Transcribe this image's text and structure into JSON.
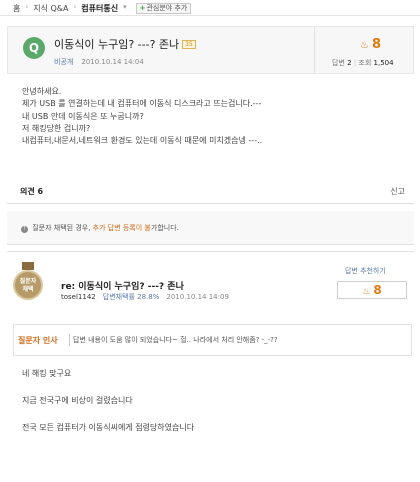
{
  "breadcrumb": {
    "items": [
      "홈",
      "지식 Q&A",
      "컴퓨터통신"
    ],
    "add_fav_label": "관심분야 추가"
  },
  "question": {
    "badge": "Q",
    "title": "이동식이 누구임? ---? 존나",
    "level_badge": "35",
    "author": "비공개",
    "date": "2010.10.14 14:04",
    "score": "8",
    "answers_label": "답변",
    "answers": "2",
    "views_label": "조회",
    "views": "1,504",
    "body": [
      "안녕하세요.",
      "제가 USB 를 연결하는데 내 컴퓨터에 이동식 디스크라고 뜨는겁니다.---",
      "내 USB 안데 이동식은 또 누굽니까?",
      "저 해킹당한 겁니까?",
      "내컴퓨터,내문서,네트워크 환경도 있는데 이동식 때문에 미치겠습넹 ---.."
    ],
    "opinion_label": "의견 6",
    "report_label": "신고"
  },
  "notice": {
    "prefix": "질문자 채택된 경우,",
    "highlight": "추가 답변 등록이 불",
    "suffix": "가합니다."
  },
  "answer": {
    "medal_line1": "질문자",
    "medal_line2": "채택",
    "title": "re: 이동식이 누구임? ---? 존나",
    "author": "tosel1142",
    "rate": "답변채택률 28.8%",
    "date": "2010.10.14 14:09",
    "recommend_label": "답변 추천하기",
    "recommend_count": "8",
    "comment_label": "질문자 인사",
    "comment_text": "답변 내용이 도움 많이 되었습니다~ 헐.. 나라에서 처리 안해줌? -_-??",
    "body": [
      "네 해킹 맞구요",
      "지금 전국구에 비상이 걸렸습니다",
      "전국 모든 컴퓨터가 이동식씨에게 점령당하였습니다"
    ]
  }
}
